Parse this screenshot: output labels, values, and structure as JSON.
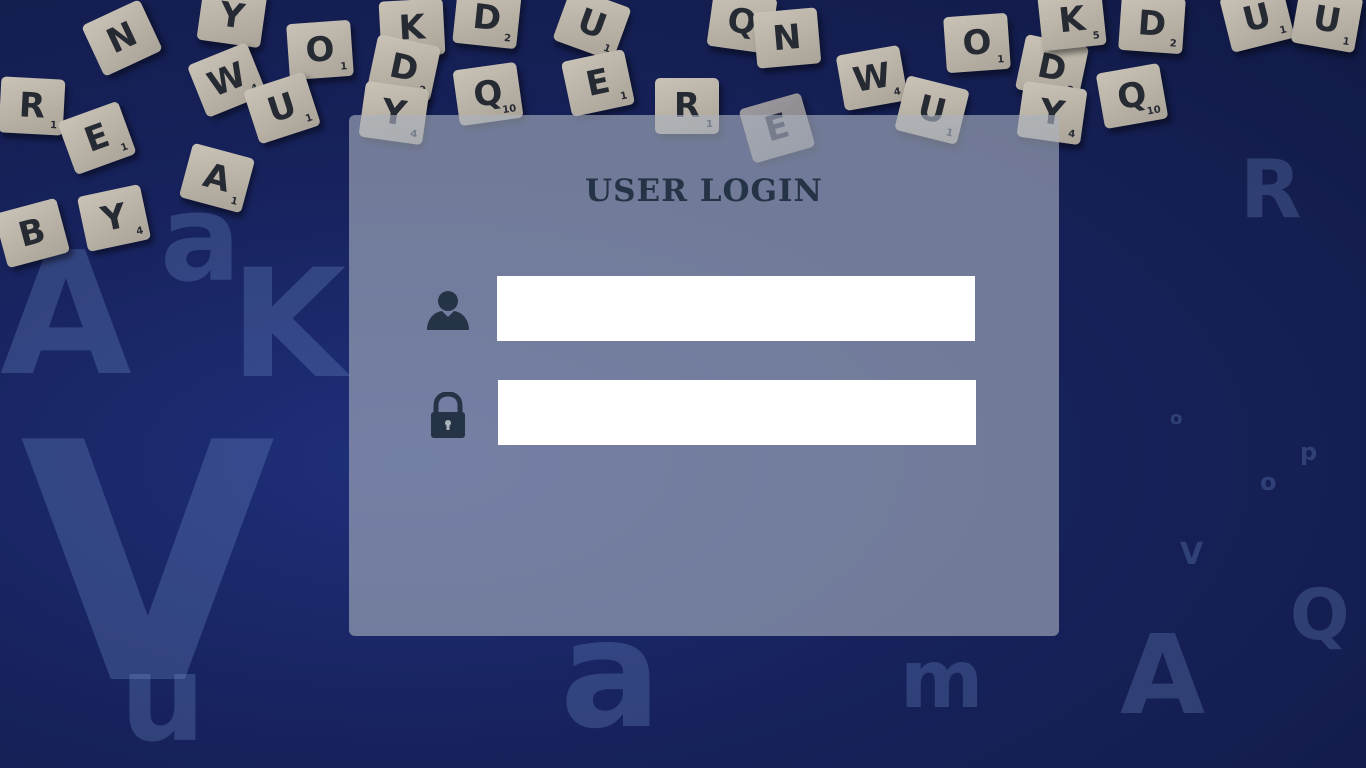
{
  "page": {
    "title": "USER LOGIN",
    "background_color": "#17225c",
    "panel_color": "#aab2be",
    "title_color": "#243446",
    "icon_color": "#243446"
  },
  "form": {
    "username": {
      "icon": "user-icon",
      "value": "",
      "placeholder": ""
    },
    "password": {
      "icon": "lock-icon",
      "value": "",
      "placeholder": ""
    }
  }
}
